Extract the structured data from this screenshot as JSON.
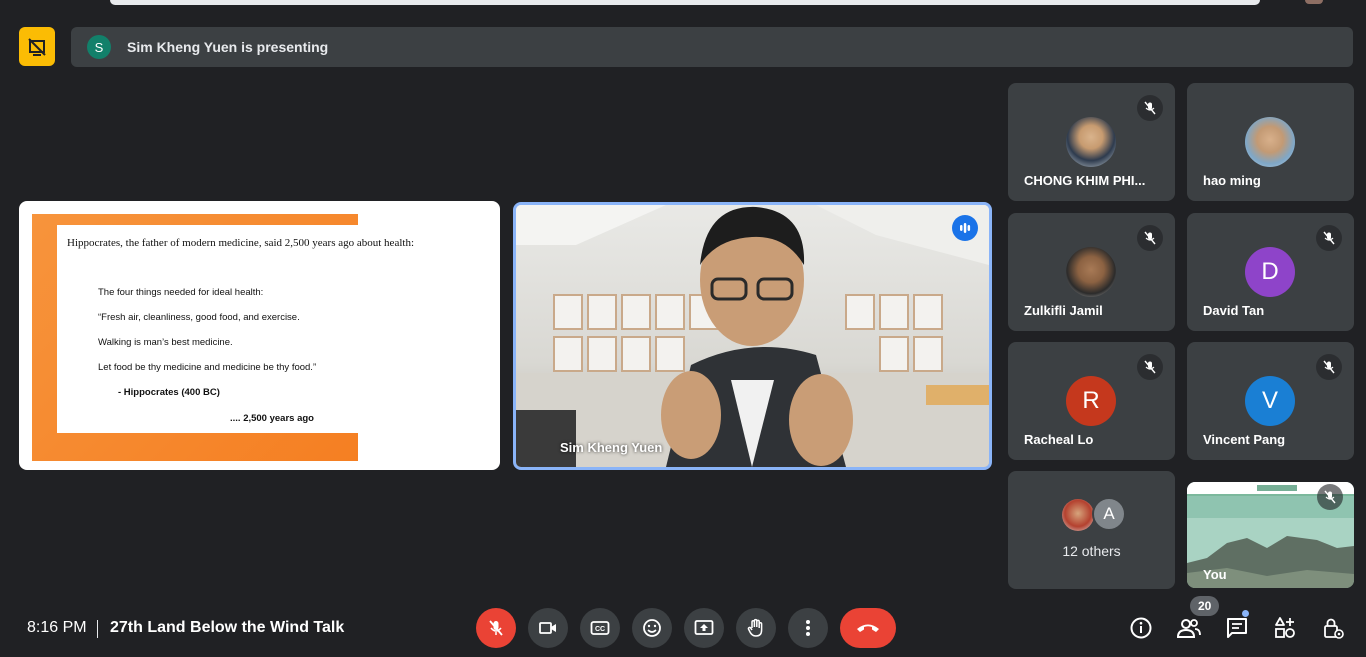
{
  "banner": {
    "avatar_letter": "S",
    "text": "Sim Kheng Yuen is presenting"
  },
  "slide": {
    "intro": "Hippocrates, the father of modern medicine, said 2,500 years ago about health:",
    "lines": [
      "The four things needed for ideal health:",
      "“Fresh air, cleanliness, good food, and exercise.",
      "Walking is man’s best medicine.",
      "Let food be thy medicine and medicine be thy food.”",
      "- Hippocrates (400 BC)",
      ".... 2,500 years ago"
    ]
  },
  "main_video": {
    "name": "Sim Kheng Yuen"
  },
  "participants": [
    {
      "name": "CHONG KHIM PHI...",
      "avatar_type": "photo",
      "muted": true
    },
    {
      "name": "hao ming",
      "avatar_type": "photo",
      "muted": false
    },
    {
      "name": "Zulkifli Jamil",
      "avatar_type": "photo",
      "muted": true
    },
    {
      "name": "David Tan",
      "avatar_letter": "D",
      "avatar_color": "#8e44c9",
      "muted": true
    },
    {
      "name": "Racheal Lo",
      "avatar_letter": "R",
      "avatar_color": "#c5381d",
      "muted": true
    },
    {
      "name": "Vincent Pang",
      "avatar_letter": "V",
      "avatar_color": "#1a7fd4",
      "muted": true
    }
  ],
  "others": {
    "avatar_letter": "A",
    "label": "12 others"
  },
  "self": {
    "name": "You",
    "muted": true
  },
  "bottom_bar": {
    "time": "8:16 PM",
    "meeting_title": "27th Land Below the Wind Talk",
    "participant_count": "20",
    "controls": [
      "mic-off-icon",
      "camera-icon",
      "captions-icon",
      "emoji-icon",
      "present-icon",
      "raise-hand-icon",
      "more-options-icon",
      "end-call-icon"
    ],
    "right_icons": [
      "info-icon",
      "people-icon",
      "chat-icon",
      "activities-icon",
      "host-controls-icon"
    ]
  },
  "colors": {
    "background": "#202124",
    "tile": "#3c4043",
    "accent_blue": "#8ab4f8",
    "end_call_red": "#ea4335",
    "present_yellow": "#fbbc04"
  }
}
